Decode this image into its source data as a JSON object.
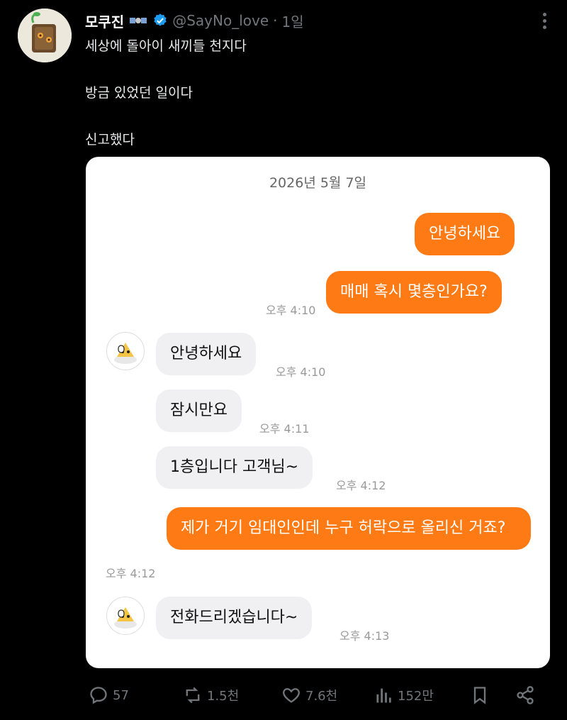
{
  "tweet": {
    "display_name": "모쿠진",
    "handle": "@SayNo_love",
    "separator": "·",
    "time": "1일",
    "lines": [
      "세상에 돌아이 새끼들 천지다",
      "방금 있었던 일이다",
      "신고했다"
    ]
  },
  "chat": {
    "date": "2026년 5월 7일",
    "messages": [
      {
        "side": "out",
        "text": "안녕하세요",
        "time": ""
      },
      {
        "side": "out",
        "text": "매매 혹시 몇층인가요?",
        "time": "오후 4:10"
      },
      {
        "side": "in",
        "text": "안녕하세요",
        "time": "오후 4:10"
      },
      {
        "side": "in",
        "text": "잠시만요",
        "time": "오후 4:11"
      },
      {
        "side": "in",
        "text": "1층입니다 고객님~",
        "time": "오후 4:12"
      },
      {
        "side": "out",
        "text": "제가 거기 임대인인데 누구 허락으로 올리신 거죠?",
        "time": "오후 4:12"
      },
      {
        "side": "in",
        "text": "전화드리겠습니다~",
        "time": "오후 4:13"
      }
    ]
  },
  "actions": {
    "replies": "57",
    "reposts": "1.5천",
    "likes": "7.6천",
    "views": "152만"
  },
  "colors": {
    "accent_orange": "#fd7a14",
    "incoming_bubble": "#f0f0f3",
    "verified_blue": "#1d9bf0",
    "muted": "#71767b"
  }
}
